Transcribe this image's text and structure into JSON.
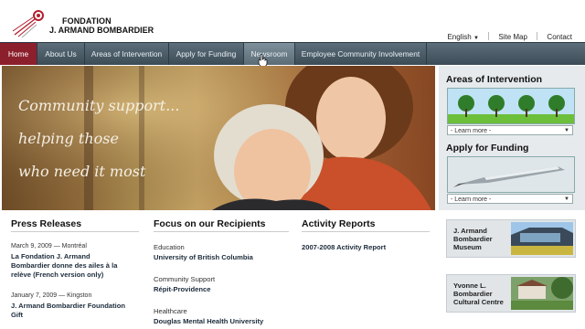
{
  "header": {
    "logo_line1": "FONDATION",
    "logo_line2": "J. ARMAND BOMBARDIER",
    "utility_links": [
      "English",
      "Site Map",
      "Contact"
    ]
  },
  "nav": {
    "items": [
      "Home",
      "About Us",
      "Areas of Intervention",
      "Apply for Funding",
      "Newsroom",
      "Employee Community Involvement"
    ],
    "active": "Home",
    "hovered": "Newsroom"
  },
  "hero": {
    "line1": "Community support...",
    "line2": "helping those",
    "line3": "who need it most"
  },
  "sidebar": {
    "areas_title": "Areas of Intervention",
    "areas_select": "- Learn more -",
    "funding_title": "Apply for Funding",
    "funding_select": "- Learn more -"
  },
  "press": {
    "heading": "Press Releases",
    "items": [
      {
        "date": "March 9, 2009 — Montréal",
        "title_lines": [
          "La Fondation J. Armand",
          "Bombardier donne des ailes à la",
          "relève (French version only)"
        ]
      },
      {
        "date": "January 7, 2009 — Kingston",
        "title_lines": [
          "J. Armand Bombardier Foundation",
          "Gift"
        ]
      }
    ]
  },
  "focus": {
    "heading": "Focus on our Recipients",
    "items": [
      {
        "category": "Education",
        "name": "University of British Columbia"
      },
      {
        "category": "Community Support",
        "name": "Répit-Providence"
      },
      {
        "category": "Healthcare",
        "name": "Douglas Mental Health University"
      }
    ]
  },
  "reports": {
    "heading": "Activity Reports",
    "link": "2007-2008 Activity Report"
  },
  "museums": [
    {
      "lines": [
        "J. Armand",
        "Bombardier",
        "Museum"
      ]
    },
    {
      "lines": [
        "Yvonne L.",
        "Bombardier",
        "Cultural Centre"
      ]
    }
  ],
  "colors": {
    "nav_active": "#8c1f2c",
    "nav_bg": "#4a5a65",
    "brand_red": "#b21f2d"
  }
}
